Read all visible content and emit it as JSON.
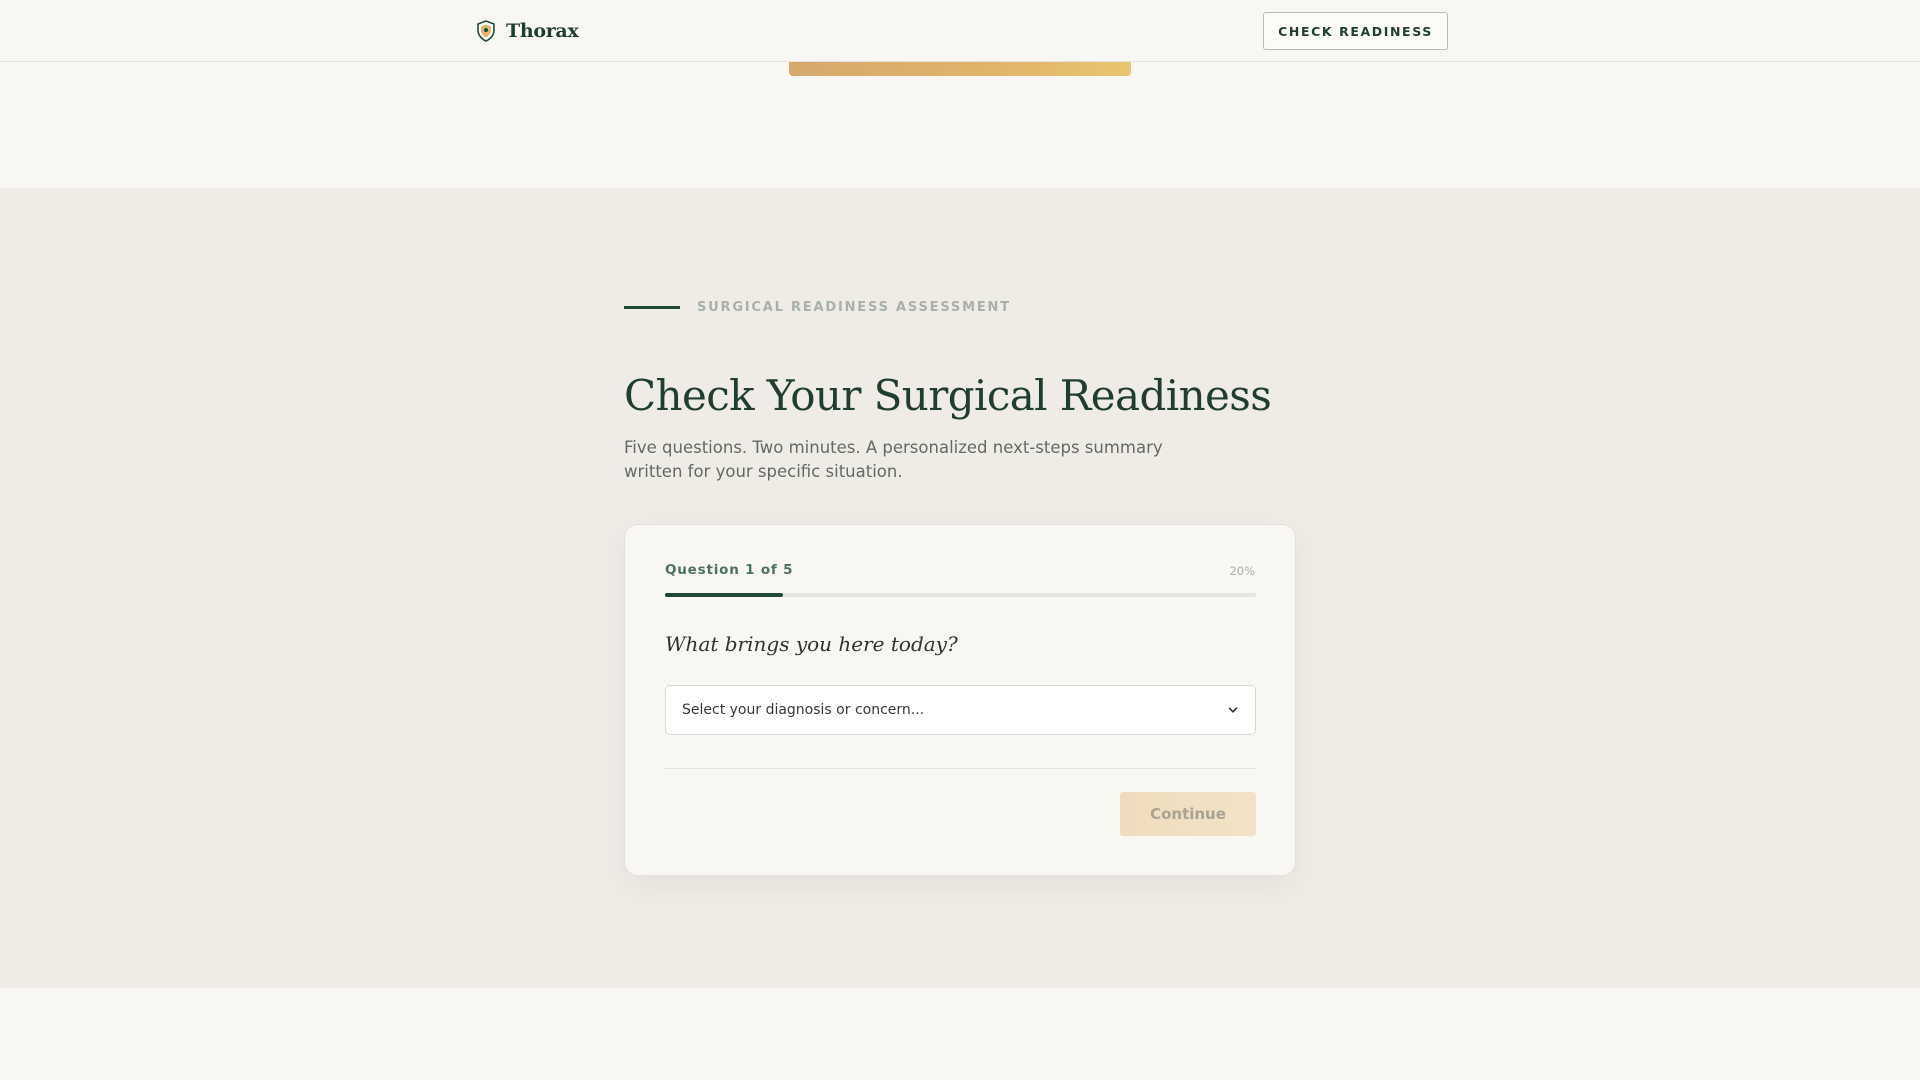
{
  "header": {
    "brand_name": "Thorax",
    "cta_label": "CHECK READINESS"
  },
  "assessment": {
    "eyebrow": "SURGICAL READINESS ASSESSMENT",
    "title": "Check Your Surgical Readiness",
    "subtitle": "Five questions. Two minutes. A personalized next-steps summary written for your specific situation.",
    "card": {
      "question_label": "Question 1 of 5",
      "progress_percent_label": "20%",
      "progress_fraction": 0.2,
      "question": "What brings you here today?",
      "select_placeholder": "Select your diagnosis or concern...",
      "continue_label": "Continue"
    }
  },
  "colors": {
    "brand_green": "#1f3d30",
    "accent_gold": "#e0b56a",
    "section_bg": "#efece6",
    "page_bg": "#f8f7f3"
  },
  "icons": {
    "brand": "shield-icon",
    "select": "chevron-down-icon"
  }
}
